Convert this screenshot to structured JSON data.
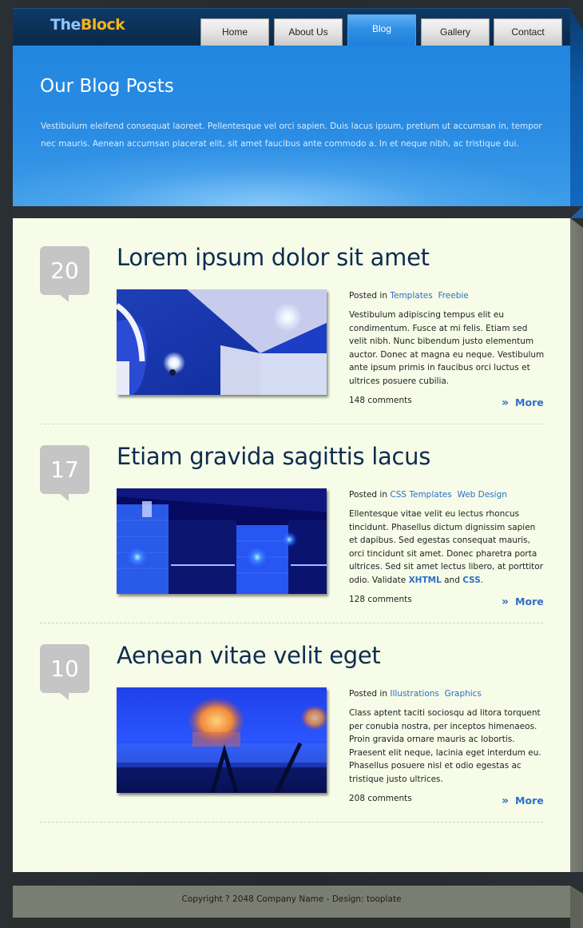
{
  "site": {
    "logo_part1": "The",
    "logo_part2": "Block"
  },
  "nav": {
    "items": [
      {
        "label": "Home",
        "active": false
      },
      {
        "label": "About Us",
        "active": false
      },
      {
        "label": "Blog",
        "active": true
      },
      {
        "label": "Gallery",
        "active": false
      },
      {
        "label": "Contact",
        "active": false
      }
    ]
  },
  "banner": {
    "title": "Our Blog Posts",
    "text": "Vestibulum eleifend consequat laoreet. Pellentesque vel orci sapien. Duis lacus ipsum, pretium ut accumsan in, tempor nec mauris. Aenean accumsan placerat elit, sit amet faucibus ante commodo a. In et neque nibh, ac tristique dui."
  },
  "posts": [
    {
      "day": "20",
      "title": "Lorem ipsum dolor sit amet",
      "posted_in_label": "Posted in",
      "categories": [
        "Templates",
        "Freebie"
      ],
      "body": "Vestibulum adipiscing tempus elit eu condimentum. Fusce at mi felis. Etiam sed velit nibh. Nunc bibendum justo elementum auctor. Donec at magna eu neque. Vestibulum ante ipsum primis in faucibus orci luctus et ultrices posuere cubilia.",
      "comments": "148 comments",
      "more_label": "More",
      "image": "blue-bathroom-ceiling-photo"
    },
    {
      "day": "17",
      "title": "Etiam gravida sagittis lacus",
      "posted_in_label": "Posted in",
      "categories": [
        "CSS Templates",
        "Web Design"
      ],
      "body_prefix": "Ellentesque vitae velit eu lectus rhoncus tincidunt. Phasellus dictum dignissim sapien et dapibus. Sed egestas consequat mauris, orci tincidunt sit amet. Donec pharetra porta ultrices. Sed sit amet lectus libero, at porttitor odio. Validate ",
      "body_link1": "XHTML",
      "body_and": " and ",
      "body_link2": "CSS",
      "body_suffix": ".",
      "comments": "128 comments",
      "more_label": "More",
      "image": "blue-lit-interior-photo"
    },
    {
      "day": "10",
      "title": "Aenean vitae velit eget",
      "posted_in_label": "Posted in",
      "categories": [
        "Illustrations",
        "Graphics"
      ],
      "body": "Class aptent taciti sociosqu ad litora torquent per conubia nostra, per inceptos himenaeos. Proin gravida ornare mauris ac lobortis. Praesent elit neque, lacinia eget interdum eu. Phasellus posuere nisl et odio egestas ac tristique justo ultrices.",
      "comments": "208 comments",
      "more_label": "More",
      "image": "blurred-candle-light-photo"
    }
  ],
  "footer": {
    "copyright": "Copyright ? 2048 Company Name - Design: tooplate"
  },
  "colors": {
    "accent": "#2d6fc5",
    "banner": "#2286e0",
    "content_bg": "#f6fce8",
    "logo_orange": "#f6b21a"
  }
}
